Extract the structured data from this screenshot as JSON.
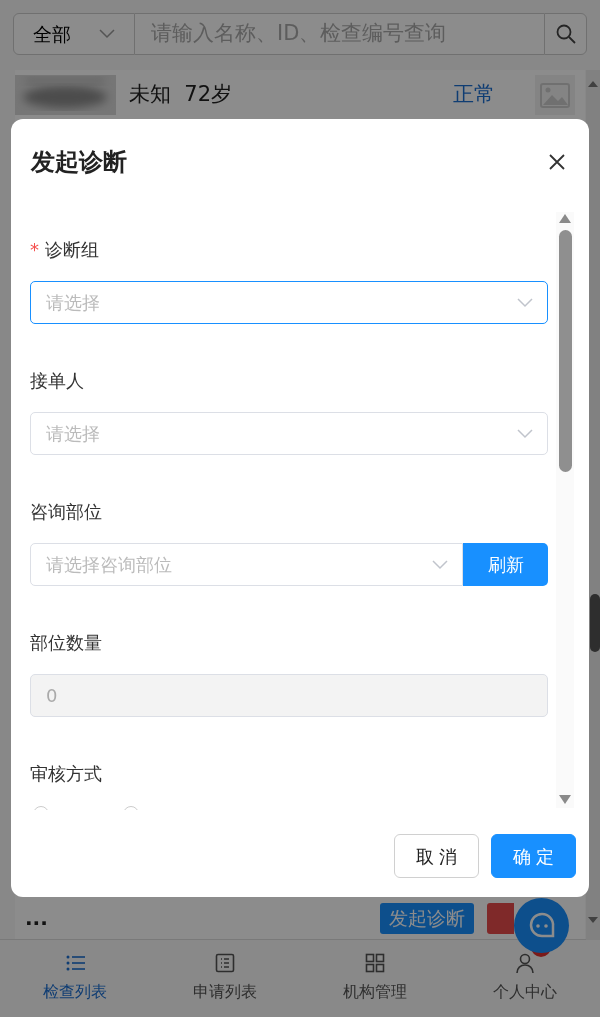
{
  "search": {
    "filter": "全部",
    "placeholder": "请输入名称、ID、检查编号查询"
  },
  "list_items": [
    {
      "kind": "patient",
      "info": "未知  72岁",
      "status": "正常"
    },
    {
      "kind": "actions",
      "more": "...",
      "buttons": [
        {
          "kind": "primary",
          "label": "发起诊断"
        },
        {
          "kind": "danger"
        }
      ]
    }
  ],
  "tabs": [
    {
      "label": "检查列表",
      "selected": true
    },
    {
      "label": "申请列表",
      "selected": false
    },
    {
      "label": "机构管理",
      "selected": false
    },
    {
      "label": "个人中心",
      "selected": false,
      "badge": true
    }
  ],
  "dialog": {
    "title": "发起诊断",
    "fields": [
      {
        "kind": "select",
        "label": "诊断组",
        "required_mark": "*",
        "placeholder": "请选择",
        "focused": true
      },
      {
        "kind": "select",
        "label": "接单人",
        "placeholder": "请选择",
        "focused": false
      },
      {
        "kind": "select_button",
        "label": "咨询部位",
        "placeholder": "请选择咨询部位",
        "button": "刷新",
        "focused": false
      },
      {
        "kind": "input",
        "label": "部位数量",
        "value": "0",
        "disabled": true
      },
      {
        "kind": "radio",
        "label": "审核方式",
        "options": [
          {
            "selected": false
          },
          {
            "selected": false
          }
        ]
      }
    ],
    "buttons": [
      {
        "label": "取 消",
        "primary": false
      },
      {
        "label": "确 定",
        "primary": true
      }
    ]
  }
}
